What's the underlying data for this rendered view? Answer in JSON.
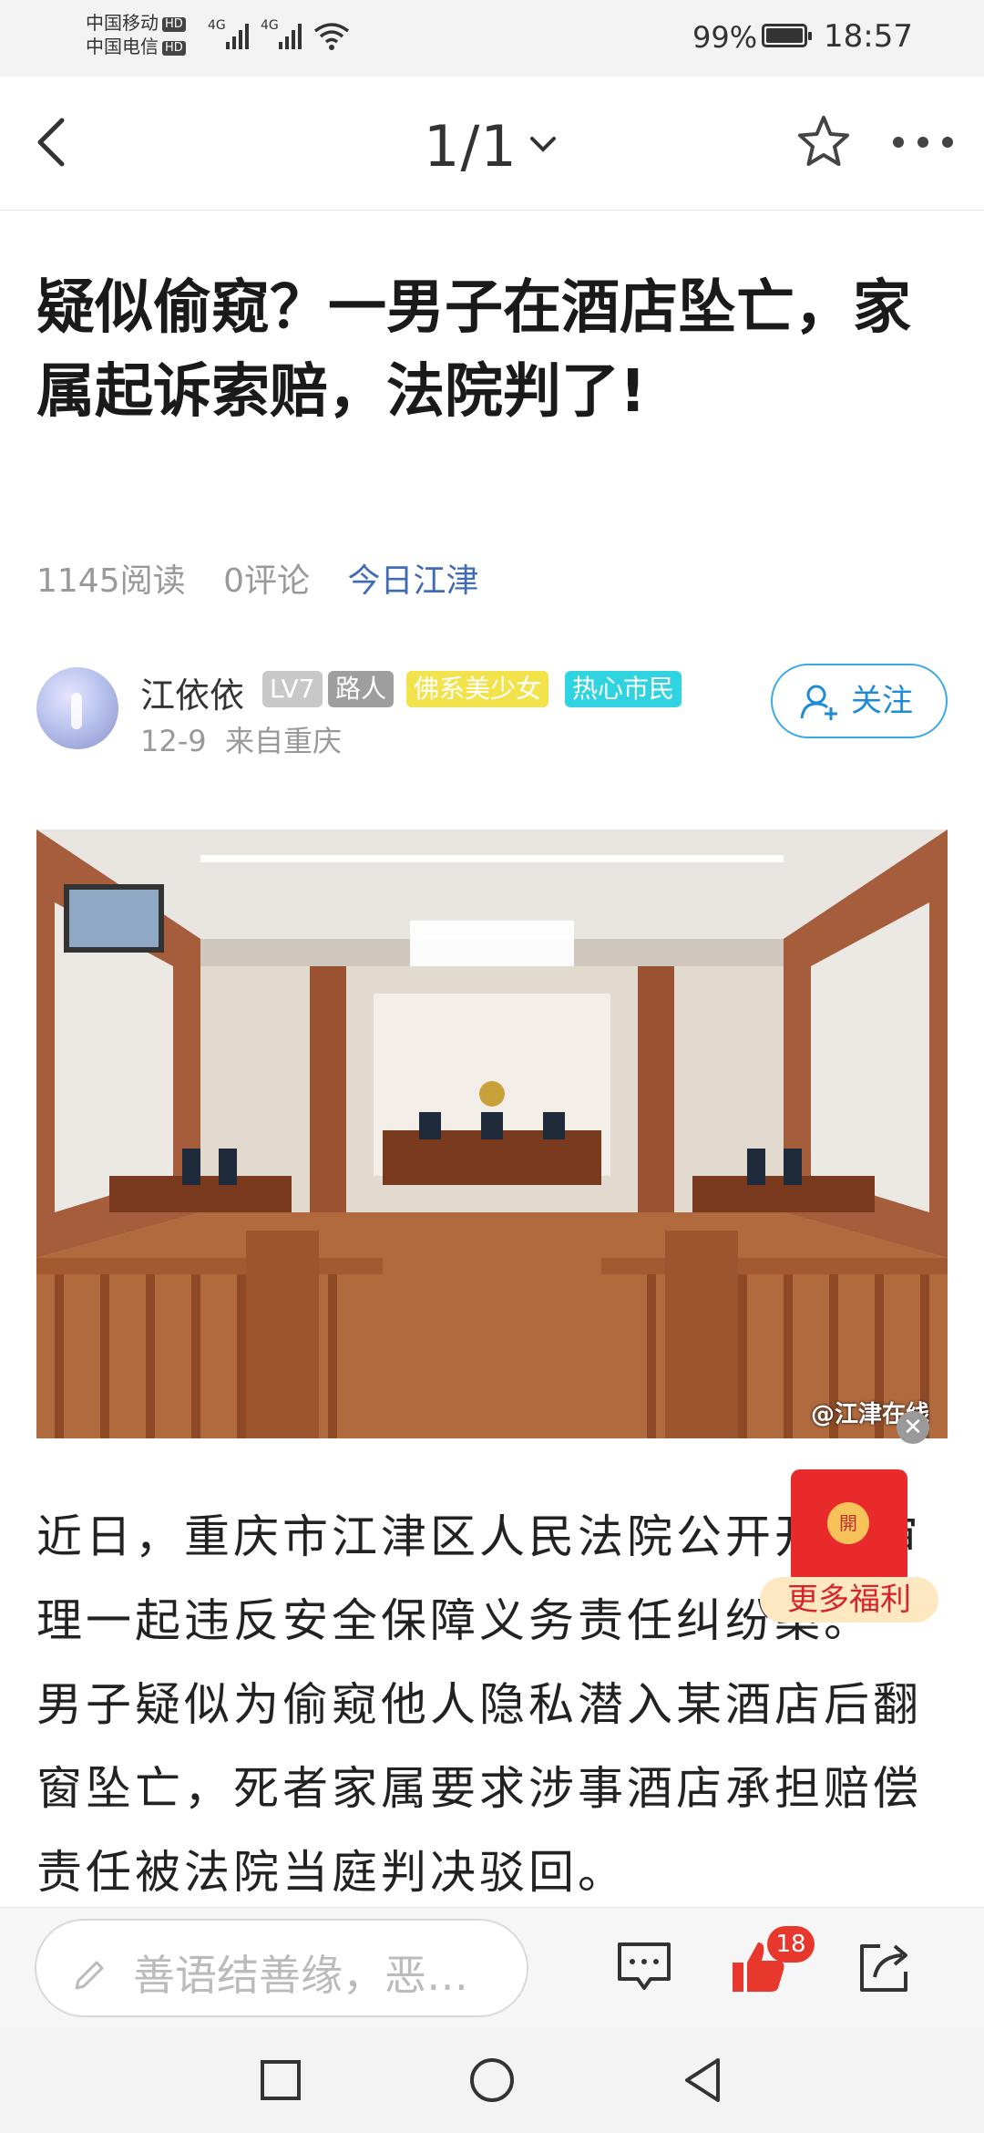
{
  "status_bar": {
    "carrier1": "中国移动",
    "carrier2": "中国电信",
    "hd": "HD",
    "net1": "4G",
    "net2": "4G",
    "battery_pct": "99%",
    "time": "18:57"
  },
  "nav": {
    "page_indicator": "1/1"
  },
  "article": {
    "title": "疑似偷窥？一男子在酒店坠亡，家属起诉索赔，法院判了!",
    "reads": "1145阅读",
    "comments": "0评论",
    "source": "今日江津"
  },
  "author": {
    "name": "江依依",
    "level": "LV7",
    "badges": [
      "路人",
      "佛系美少女",
      "热心市民"
    ],
    "date": "12-9",
    "location": "来自重庆",
    "follow_label": "关注"
  },
  "photo": {
    "watermark": "@江津在线"
  },
  "body": {
    "text": "近日，重庆市江津区人民法院公开开庭审理一起违反安全保障义务责任纠纷案。一男子疑似为偷窥他人隐私潜入某酒店后翻窗坠亡，死者家属要求涉事酒店承担赔偿责任被法院当庭判决驳回。"
  },
  "red_packet": {
    "coin": "開",
    "label": "更多福利"
  },
  "bottom_bar": {
    "comment_placeholder": "善语结善缘，恶…",
    "like_count": "18"
  },
  "icons": {
    "accent": "#3aa9e8",
    "like_color": "#e8372c"
  }
}
